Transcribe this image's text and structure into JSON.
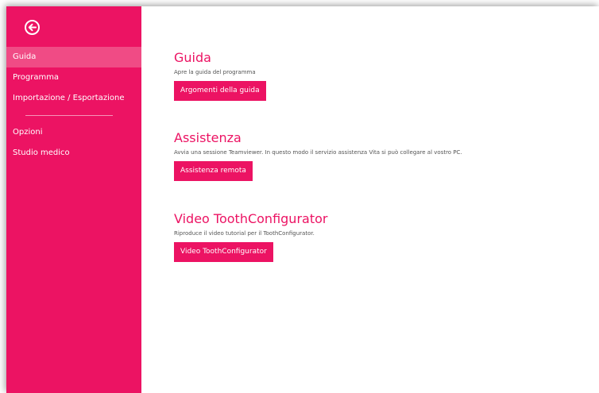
{
  "colors": {
    "accent": "#ec1363",
    "sidebar_active": "#f04b85",
    "background": "#ffffff"
  },
  "header": {
    "back_icon": "arrow-left-circle-icon"
  },
  "sidebar": {
    "items": [
      {
        "label": "Guida",
        "active": true
      },
      {
        "label": "Programma",
        "active": false
      },
      {
        "label": "Importazione / Esportazione",
        "active": false
      },
      {
        "label": "Opzioni",
        "active": false
      },
      {
        "label": "Studio medico",
        "active": false
      }
    ]
  },
  "main": {
    "sections": [
      {
        "title": "Guida",
        "description": "Apre la guida del programma",
        "button": "Argomenti della guida"
      },
      {
        "title": "Assistenza",
        "description": "Avvia una sessione Teamviewer. In questo modo il servizio assistenza Vita si può collegare al vostro PC.",
        "button": "Assistenza remota"
      },
      {
        "title": "Video ToothConfigurator",
        "description": "Riproduce il video tutorial per il ToothConfigurator.",
        "button": "Video ToothConfigurator"
      }
    ]
  }
}
